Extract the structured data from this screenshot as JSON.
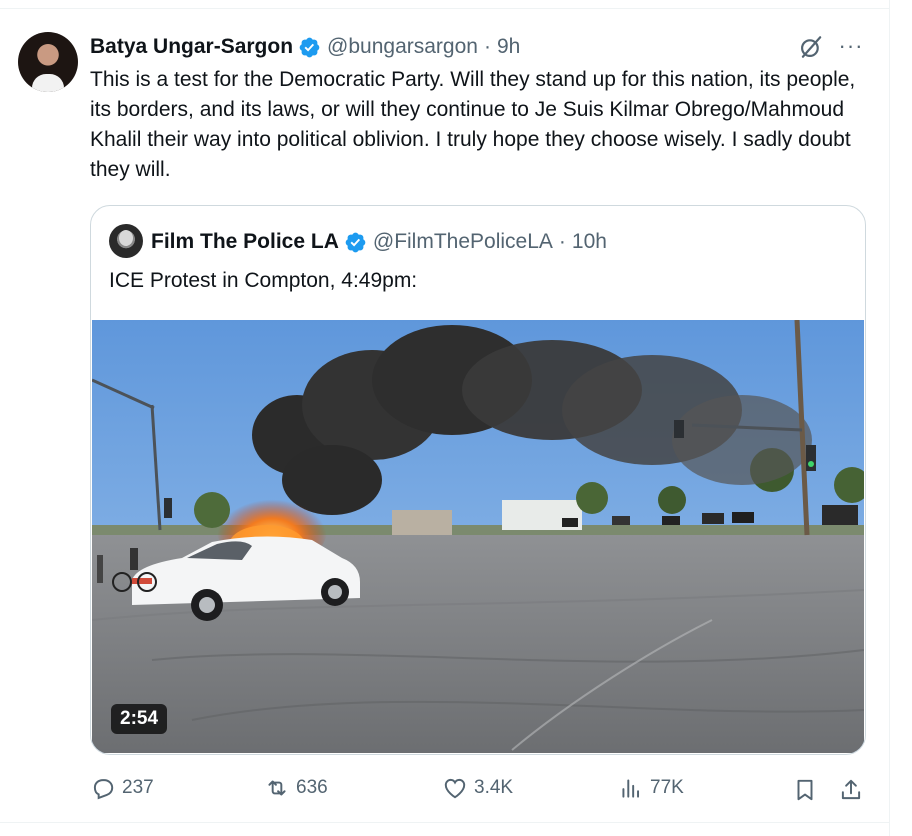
{
  "post": {
    "author_name": "Batya Ungar-Sargon",
    "handle": "@bungarsargon",
    "separator": "·",
    "time": "9h",
    "text": "This is a test for the Democratic Party. Will they stand up for this nation, its people, its borders, and its laws, or will they continue to Je Suis Kilmar Obrego/Mahmoud Khalil their way into political oblivion. I truly hope they choose wisely. I sadly doubt they will.",
    "more_label": "···"
  },
  "quote": {
    "author_name": "Film The Police LA",
    "handle": "@FilmThePoliceLA",
    "separator": "·",
    "time": "10h",
    "text": "ICE Protest in Compton, 4:49pm:",
    "video_duration": "2:54"
  },
  "actions": {
    "replies": "237",
    "reposts": "636",
    "likes": "3.4K",
    "views": "77K"
  },
  "colors": {
    "verified_blue": "#1d9bf0",
    "muted_text": "#536471",
    "border": "#cfd9de"
  },
  "icons": [
    "verified-icon",
    "grok-icon",
    "more-icon",
    "reply-icon",
    "repost-icon",
    "like-icon",
    "views-icon",
    "bookmark-icon",
    "share-icon"
  ]
}
